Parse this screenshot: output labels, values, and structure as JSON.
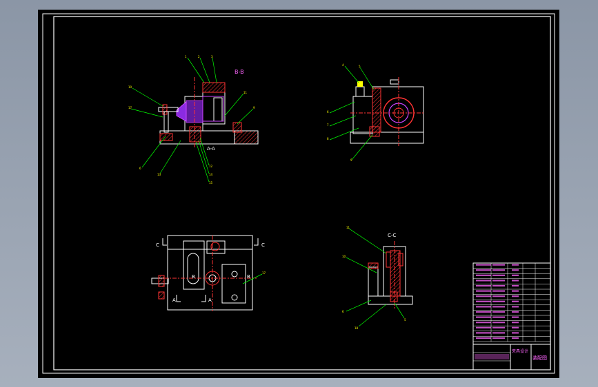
{
  "views": {
    "section_bb": {
      "title": "B-B",
      "subtitle": "A-A"
    },
    "side_view": {
      "title": ""
    },
    "top_view": {
      "cut_c_left": "C",
      "cut_c_right": "C",
      "cut_b_left": "B",
      "cut_b_right": "B",
      "cut_a_left": "A",
      "cut_a_right": "A"
    },
    "section_cc": {
      "title": "C-C"
    }
  },
  "balloons": {
    "bb": [
      "1",
      "2",
      "3",
      "10",
      "11",
      "13",
      "9",
      "6",
      "12",
      "14",
      "15",
      "16",
      "17"
    ],
    "side": [
      "4",
      "5",
      "6",
      "7",
      "8",
      "9"
    ],
    "top": [
      "17"
    ],
    "cc": [
      "11",
      "10",
      "6",
      "18",
      "5"
    ]
  },
  "title_block": {
    "part_rows": 15,
    "title_text": "夹具设计",
    "name_text": "装配图"
  },
  "colors": {
    "background": "#000000",
    "frame": "#ffffff",
    "geometry": "#ffffff",
    "section_hatch": "#ff3333",
    "centerline": "#ff3333",
    "leader": "#00ff00",
    "purple": "#cc44ff",
    "title_text": "#ff66ff"
  }
}
